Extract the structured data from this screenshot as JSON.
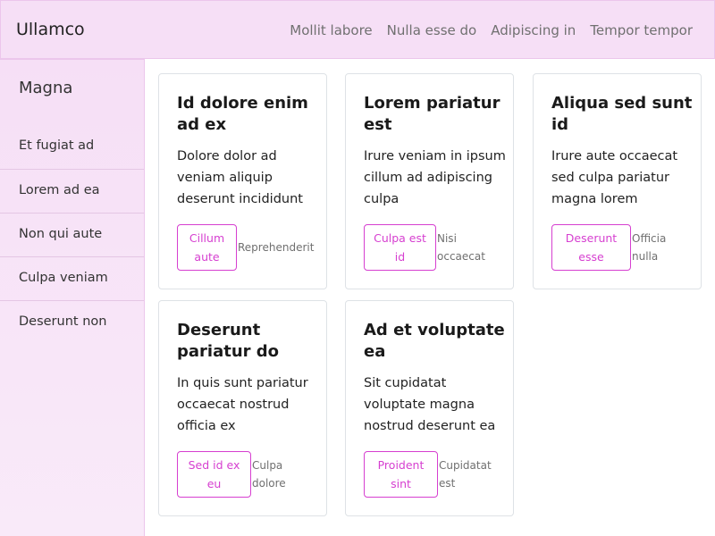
{
  "navbar": {
    "brand": "Ullamco",
    "links": [
      "Mollit labore",
      "Nulla esse do",
      "Adipiscing in",
      "Tempor tempor"
    ]
  },
  "sidebar": {
    "title": "Magna",
    "items": [
      "Et fugiat ad",
      "Lorem ad ea",
      "Non qui aute",
      "Culpa veniam",
      "Deserunt non"
    ]
  },
  "cards": [
    {
      "title": "Id dolore enim ad ex",
      "text": "Dolore dolor ad veniam aliquip deserunt incididunt",
      "button": "Cillum aute",
      "meta": "Reprehenderit"
    },
    {
      "title": "Lorem pariatur est",
      "text": "Irure veniam in ipsum cillum ad adipiscing culpa",
      "button": "Culpa est id",
      "meta": "Nisi occaecat"
    },
    {
      "title": "Aliqua sed sunt id",
      "text": "Irure aute occaecat sed culpa pariatur magna lorem",
      "button": "Deserunt esse",
      "meta": "Officia nulla"
    },
    {
      "title": "Deserunt pariatur do",
      "text": "In quis sunt pariatur occaecat nostrud officia ex",
      "button": "Sed id ex eu",
      "meta": "Culpa dolore"
    },
    {
      "title": "Ad et voluptate ea",
      "text": "Sit cupidatat voluptate magna nostrud deserunt ea",
      "button": "Proident sint",
      "meta": "Cupidatat est"
    }
  ],
  "colors": {
    "accent": "#d63fd0",
    "navbar_bg": "#f6dff6",
    "sidebar_bg": "#f6dff6"
  }
}
